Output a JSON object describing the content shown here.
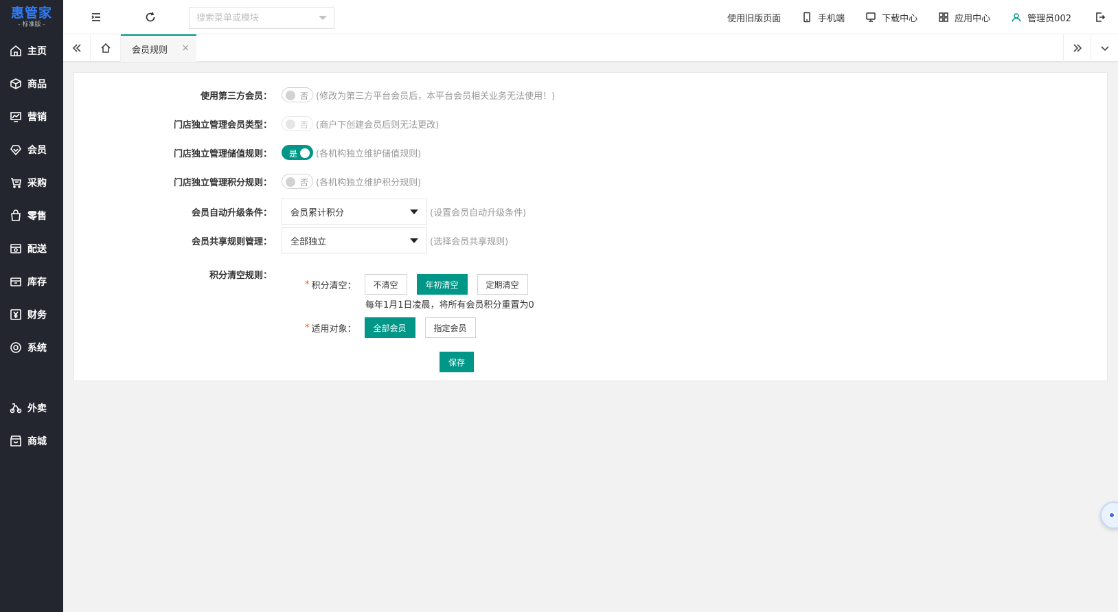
{
  "logo": {
    "title": "惠管家",
    "subtitle": "- 标准版 -"
  },
  "sidebar": {
    "items": [
      {
        "label": "主页",
        "icon": "home-icon"
      },
      {
        "label": "商品",
        "icon": "cube-icon"
      },
      {
        "label": "营销",
        "icon": "chart-icon"
      },
      {
        "label": "会员",
        "icon": "diamond-icon"
      },
      {
        "label": "采购",
        "icon": "cart-icon"
      },
      {
        "label": "零售",
        "icon": "bag-icon"
      },
      {
        "label": "配送",
        "icon": "delivery-icon"
      },
      {
        "label": "库存",
        "icon": "inventory-icon"
      },
      {
        "label": "财务",
        "icon": "yen-icon"
      },
      {
        "label": "系统",
        "icon": "settings-icon"
      }
    ],
    "extra_items": [
      {
        "label": "外卖",
        "icon": "takeaway-icon"
      },
      {
        "label": "商城",
        "icon": "mall-icon"
      }
    ]
  },
  "topbar": {
    "search_placeholder": "搜索菜单或模块",
    "old_page": "使用旧版页面",
    "mobile": "手机端",
    "download": "下载中心",
    "apps": "应用中心",
    "user": "管理员002"
  },
  "tabs": {
    "active": "会员规则",
    "close": "×"
  },
  "form": {
    "third_party": {
      "label": "使用第三方会员：",
      "switch_text": "否",
      "hint": "(修改为第三方平台会员后，本平台会员相关业务无法使用！)"
    },
    "store_member_type": {
      "label": "门店独立管理会员类型：",
      "switch_text": "否",
      "hint": "(商户下创建会员后则无法更改)"
    },
    "store_stored_value": {
      "label": "门店独立管理储值规则：",
      "switch_text": "是",
      "hint": "(各机构独立维护储值规则)"
    },
    "store_points": {
      "label": "门店独立管理积分规则：",
      "switch_text": "否",
      "hint": "(各机构独立维护积分规则)"
    },
    "auto_upgrade": {
      "label": "会员自动升级条件：",
      "value": "会员累计积分",
      "hint": "(设置会员自动升级条件)"
    },
    "share_rule": {
      "label": "会员共享规则管理：",
      "value": "全部独立",
      "hint": "(选择会员共享规则)"
    },
    "points_clear": {
      "label": "积分清空规则：",
      "clear_label": "积分清空：",
      "options": [
        "不清空",
        "年初清空",
        "定期清空"
      ],
      "selected": "年初清空",
      "note": "每年1月1日凌晨，将所有会员积分重置为0",
      "target_label": "适用对象：",
      "targets": [
        "全部会员",
        "指定会员"
      ],
      "selected_target": "全部会员",
      "required_mark": "*"
    },
    "save": "保存"
  },
  "colors": {
    "primary": "#009688",
    "sidebar": "#23262e",
    "logo": "#2f7bf5",
    "required": "#ff5722"
  }
}
